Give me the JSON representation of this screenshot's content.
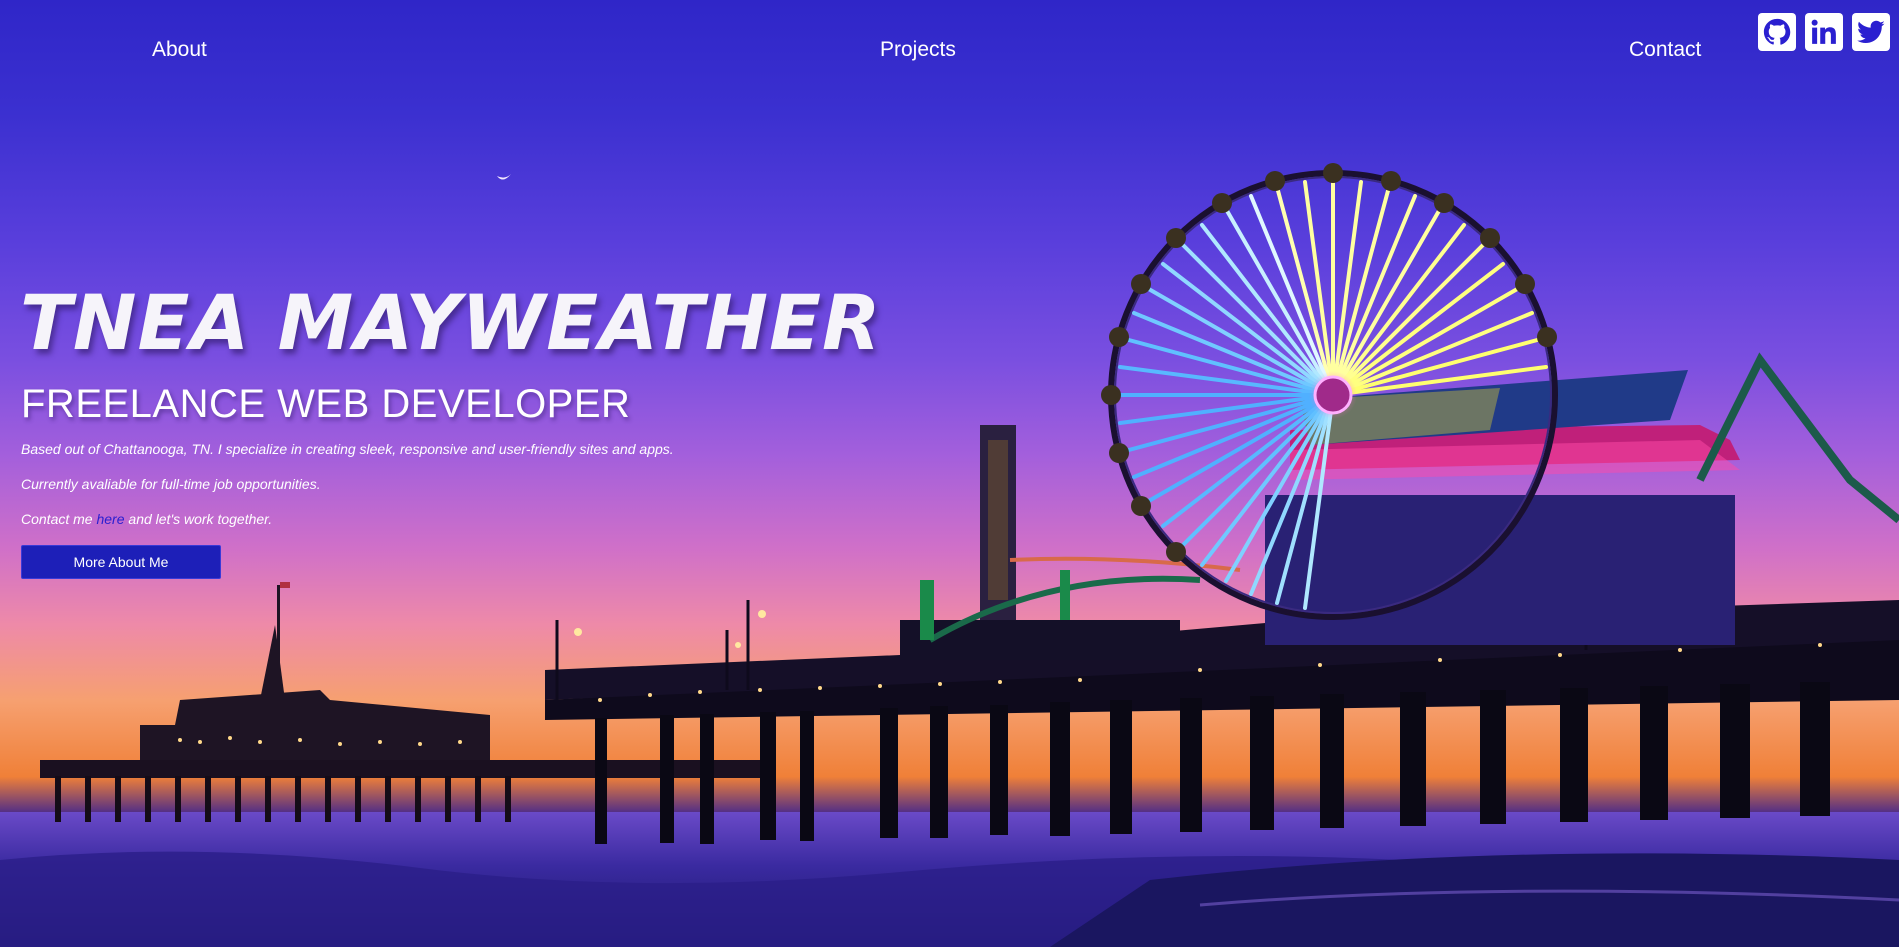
{
  "nav": {
    "about": "About",
    "projects": "Projects",
    "contact": "Contact"
  },
  "social": [
    {
      "icon": "github-icon"
    },
    {
      "icon": "linkedin-icon"
    },
    {
      "icon": "twitter-icon"
    }
  ],
  "hero": {
    "name": "TNEA MAYWEATHER",
    "role": "FREELANCE WEB DEVELOPER",
    "line1": "Based out of Chattanooga, TN. I specialize in creating sleek, responsive and user-friendly sites and apps.",
    "line2": "Currently avaliable for full-time job opportunities.",
    "line3_before": "Contact me ",
    "line3_link": "here",
    "line3_after": " and let's work together.",
    "cta": "More About Me"
  },
  "colors": {
    "sky_top": "#2f26c8",
    "sunset": "#f08038",
    "button": "#1d1fb8",
    "link": "#2a1fd0"
  }
}
